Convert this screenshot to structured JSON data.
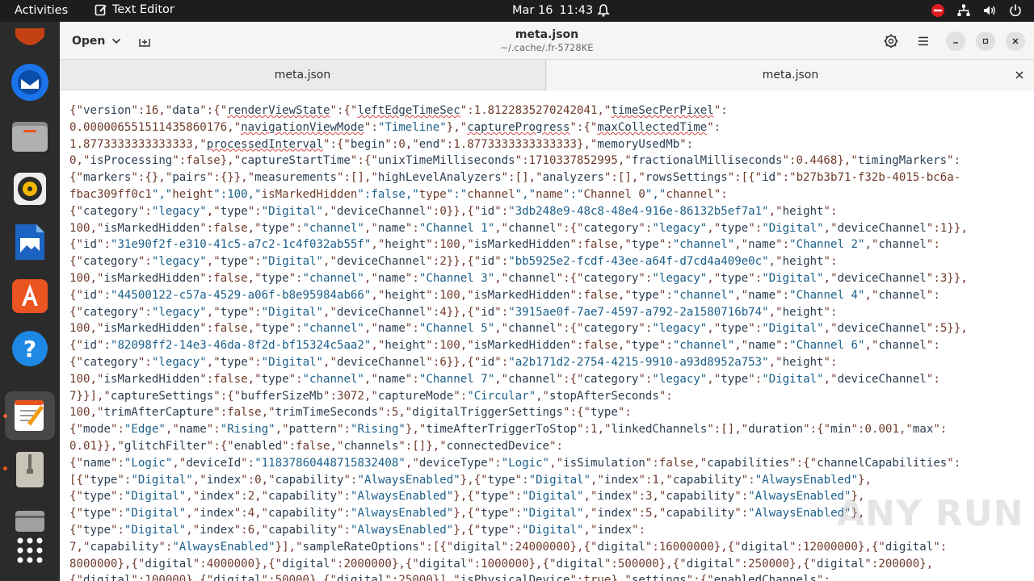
{
  "topbar": {
    "activities": "Activities",
    "app_name": "Text Editor",
    "date": "Mar 16",
    "time": "11:43"
  },
  "dock": {
    "items": [
      "ubuntu-icon",
      "thunderbird-icon",
      "files-icon",
      "rhythmbox-icon",
      "writer-icon",
      "software-center-icon",
      "help-icon",
      "text-editor-icon",
      "archive-icon",
      "disk-icon",
      "apps-grid-icon"
    ]
  },
  "header": {
    "open_label": "Open",
    "title": "meta.json",
    "subtitle": "~/.cache/.fr-5728KE"
  },
  "tabs": [
    {
      "label": "meta.json"
    },
    {
      "label": "meta.json"
    }
  ],
  "editor": {
    "lines": [
      "{\"version\":16,\"data\":{\"renderViewState\":{\"leftEdgeTimeSec\":1.8122835270242041,\"timeSecPerPixel\":",
      "0.000006551511435860176,\"navigationViewMode\":\"Timeline\"},\"captureProgress\":{\"maxCollectedTime\":",
      "1.8773333333333333,\"processedInterval\":{\"begin\":0,\"end\":1.8773333333333333},\"memoryUsedMb\":",
      "0,\"isProcessing\":false},\"captureStartTime\":{\"unixTimeMilliseconds\":1710337852995,\"fractionalMilliseconds\":0.4468},\"timingMarkers\":",
      "{\"markers\":{},\"pairs\":{}},\"measurements\":[],\"highLevelAnalyzers\":[],\"analyzers\":[],\"rowsSettings\":[{\"id\":\"b27b3b71-f32b-4015-bc6a-",
      "fbac309ff0c1\",\"height\":100,\"isMarkedHidden\":false,\"type\":\"channel\",\"name\":\"Channel 0\",\"channel\":",
      "{\"category\":\"legacy\",\"type\":\"Digital\",\"deviceChannel\":0}},{\"id\":\"3db248e9-48c8-48e4-916e-86132b5ef7a1\",\"height\":",
      "100,\"isMarkedHidden\":false,\"type\":\"channel\",\"name\":\"Channel 1\",\"channel\":{\"category\":\"legacy\",\"type\":\"Digital\",\"deviceChannel\":1}},",
      "{\"id\":\"31e90f2f-e310-41c5-a7c2-1c4f032ab55f\",\"height\":100,\"isMarkedHidden\":false,\"type\":\"channel\",\"name\":\"Channel 2\",\"channel\":",
      "{\"category\":\"legacy\",\"type\":\"Digital\",\"deviceChannel\":2}},{\"id\":\"bb5925e2-fcdf-43ee-a64f-d7cd4a409e0c\",\"height\":",
      "100,\"isMarkedHidden\":false,\"type\":\"channel\",\"name\":\"Channel 3\",\"channel\":{\"category\":\"legacy\",\"type\":\"Digital\",\"deviceChannel\":3}},",
      "{\"id\":\"44500122-c57a-4529-a06f-b8e95984ab66\",\"height\":100,\"isMarkedHidden\":false,\"type\":\"channel\",\"name\":\"Channel 4\",\"channel\":",
      "{\"category\":\"legacy\",\"type\":\"Digital\",\"deviceChannel\":4}},{\"id\":\"3915ae0f-7ae7-4597-a792-2a1580716b74\",\"height\":",
      "100,\"isMarkedHidden\":false,\"type\":\"channel\",\"name\":\"Channel 5\",\"channel\":{\"category\":\"legacy\",\"type\":\"Digital\",\"deviceChannel\":5}},",
      "{\"id\":\"82098ff2-14e3-46da-8f2d-bf15324c5aa2\",\"height\":100,\"isMarkedHidden\":false,\"type\":\"channel\",\"name\":\"Channel 6\",\"channel\":",
      "{\"category\":\"legacy\",\"type\":\"Digital\",\"deviceChannel\":6}},{\"id\":\"a2b171d2-2754-4215-9910-a93d8952a753\",\"height\":",
      "100,\"isMarkedHidden\":false,\"type\":\"channel\",\"name\":\"Channel 7\",\"channel\":{\"category\":\"legacy\",\"type\":\"Digital\",\"deviceChannel\":",
      "7}}],\"captureSettings\":{\"bufferSizeMb\":3072,\"captureMode\":\"Circular\",\"stopAfterSeconds\":",
      "100,\"trimAfterCapture\":false,\"trimTimeSeconds\":5,\"digitalTriggerSettings\":{\"type\":",
      "{\"mode\":\"Edge\",\"name\":\"Rising\",\"pattern\":\"Rising\"},\"timeAfterTriggerToStop\":1,\"linkedChannels\":[],\"duration\":{\"min\":0.001,\"max\":",
      "0.01}},\"glitchFilter\":{\"enabled\":false,\"channels\":[]},\"connectedDevice\":",
      "{\"name\":\"Logic\",\"deviceId\":\"11837860448715832408\",\"deviceType\":\"Logic\",\"isSimulation\":false,\"capabilities\":{\"channelCapabilities\":",
      "[{\"type\":\"Digital\",\"index\":0,\"capability\":\"AlwaysEnabled\"},{\"type\":\"Digital\",\"index\":1,\"capability\":\"AlwaysEnabled\"},",
      "{\"type\":\"Digital\",\"index\":2,\"capability\":\"AlwaysEnabled\"},{\"type\":\"Digital\",\"index\":3,\"capability\":\"AlwaysEnabled\"},",
      "{\"type\":\"Digital\",\"index\":4,\"capability\":\"AlwaysEnabled\"},{\"type\":\"Digital\",\"index\":5,\"capability\":\"AlwaysEnabled\"},",
      "{\"type\":\"Digital\",\"index\":6,\"capability\":\"AlwaysEnabled\"},{\"type\":\"Digital\",\"index\":",
      "7,\"capability\":\"AlwaysEnabled\"}],\"sampleRateOptions\":[{\"digital\":24000000},{\"digital\":16000000},{\"digital\":12000000},{\"digital\":",
      "8000000},{\"digital\":4000000},{\"digital\":2000000},{\"digital\":1000000},{\"digital\":500000},{\"digital\":250000},{\"digital\":200000},",
      "{\"digital\":100000},{\"digital\":50000},{\"digital\":25000}],\"isPhysicalDevice\":true},\"settings\":{\"enabledChannels\":"
    ]
  },
  "watermark": "ANY RUN",
  "colors": {
    "accent": "#e95420",
    "topbar": "#1d1d1d",
    "dock": "#2b2b2b"
  }
}
